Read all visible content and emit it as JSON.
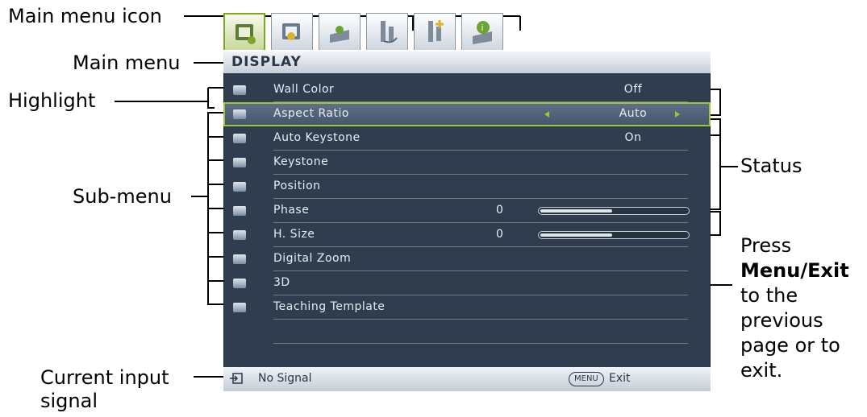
{
  "callouts": {
    "main_menu_icon": "Main menu icon",
    "main_menu": "Main menu",
    "highlight": "Highlight",
    "sub_menu": "Sub-menu",
    "current_input_line1": "Current input",
    "current_input_line2": "signal",
    "status": "Status",
    "press": "Press",
    "menu_exit": "Menu/Exit",
    "to_the": "to the",
    "previous": "previous",
    "page_or_to": "page or to",
    "exit": "exit."
  },
  "osd": {
    "tabs": [
      {
        "icon": "display-icon",
        "active": true
      },
      {
        "icon": "picture-icon"
      },
      {
        "icon": "source-icon"
      },
      {
        "icon": "system-setup-basic-icon"
      },
      {
        "icon": "system-setup-advanced-icon"
      },
      {
        "icon": "information-icon"
      }
    ],
    "title": "DISPLAY",
    "items": [
      {
        "label": "Wall Color",
        "value": "Off"
      },
      {
        "label": "Aspect Ratio",
        "value": "Auto",
        "highlighted": true
      },
      {
        "label": "Auto Keystone",
        "value": "On"
      },
      {
        "label": "Keystone",
        "value": ""
      },
      {
        "label": "Position",
        "value": ""
      },
      {
        "label": "Phase",
        "number": "0",
        "level": 0.48
      },
      {
        "label": "H. Size",
        "number": "0",
        "level": 0.48
      },
      {
        "label": "Digital Zoom",
        "value": ""
      },
      {
        "label": "3D",
        "value": ""
      },
      {
        "label": "Teaching Template",
        "value": ""
      }
    ],
    "status_bar": {
      "signal": "No Signal",
      "menu_key": "MENU",
      "exit": "Exit"
    }
  },
  "colors": {
    "osd_bg": "#2f3d4f",
    "highlight": "#9cc43c",
    "active_tab": "#c8d99a"
  }
}
